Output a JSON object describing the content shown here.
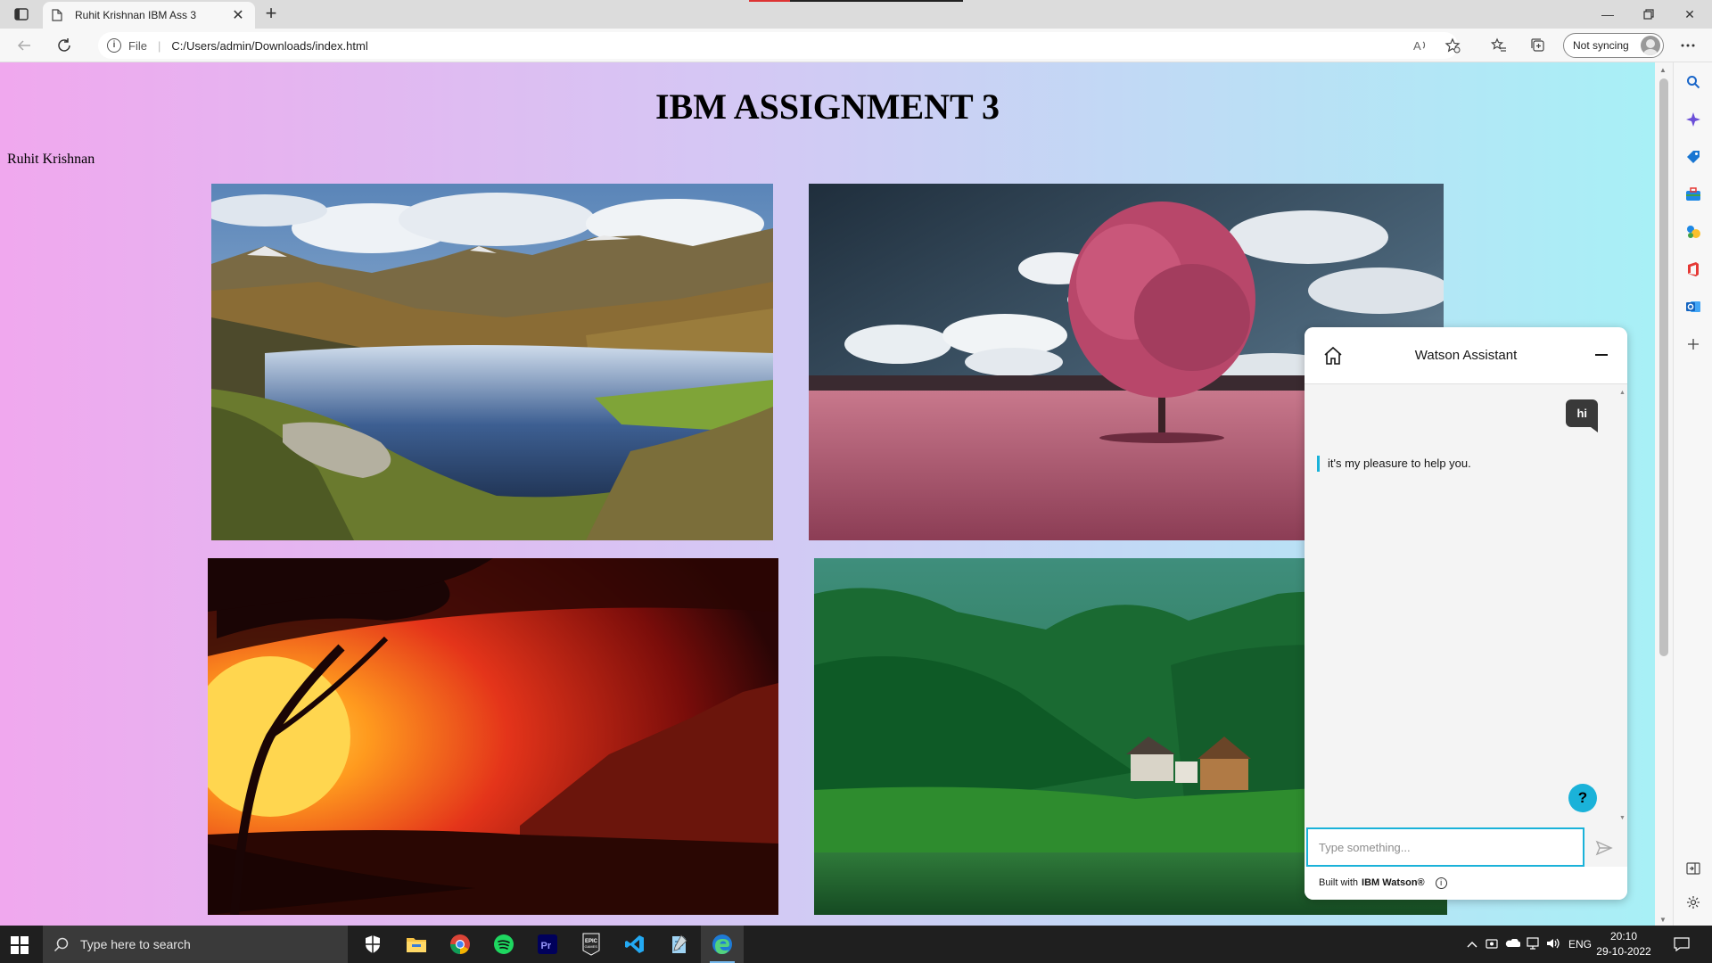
{
  "browser": {
    "tab_title": "Ruhit Krishnan IBM Ass 3",
    "address_prefix": "File",
    "address_url": "C:/Users/admin/Downloads/index.html",
    "sync_label": "Not syncing"
  },
  "page": {
    "title": "IBM ASSIGNMENT 3",
    "author": "Ruhit Krishnan"
  },
  "chat": {
    "title": "Watson Assistant",
    "user_message": "hi",
    "bot_message": "it's my pleasure to help you.",
    "help_label": "?",
    "input_placeholder": "Type something...",
    "footer_prefix": "Built with",
    "footer_brand": "IBM Watson®",
    "accent_color": "#1ab2d9"
  },
  "taskbar": {
    "search_placeholder": "Type here to search",
    "language": "ENG",
    "time": "20:10",
    "date": "29-10-2022",
    "apps": [
      "security-icon",
      "file-explorer-icon",
      "chrome-icon",
      "spotify-icon",
      "premiere-pro-icon",
      "epic-games-icon",
      "vscode-icon",
      "notepad-icon",
      "edge-icon"
    ]
  }
}
